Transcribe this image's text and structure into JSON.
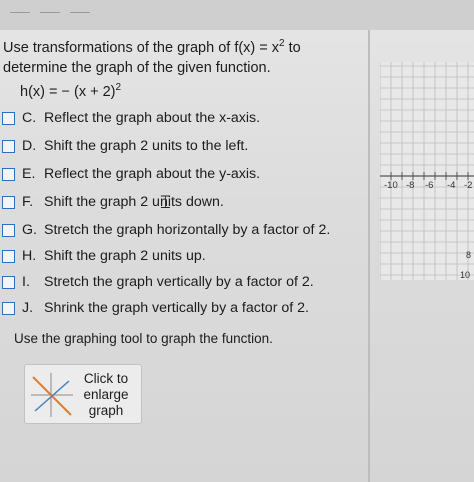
{
  "question": {
    "line1": "Use transformations of the graph of f(x) = x",
    "line1_exp": "2",
    "line1_end": " to",
    "line2": "determine the graph of the given function.",
    "function_base": "h(x) = − (x + 2)",
    "function_exp": "2"
  },
  "options": [
    {
      "letter": "C.",
      "text": "Reflect the graph about the x-axis."
    },
    {
      "letter": "D.",
      "text": "Shift the graph 2 units to the left."
    },
    {
      "letter": "E.",
      "text": "Reflect the graph about the y-axis."
    },
    {
      "letter": "F.",
      "text": "Shift the graph 2 units down."
    },
    {
      "letter": "G.",
      "text": "Stretch the graph horizontally by a factor of 2."
    },
    {
      "letter": "H.",
      "text": "Shift the graph 2 units up."
    },
    {
      "letter": "I.",
      "text": "Stretch the graph vertically by a factor of 2."
    },
    {
      "letter": "J.",
      "text": "Shrink the graph vertically by a factor of 2."
    }
  ],
  "instruction": "Use the graphing tool to graph the function.",
  "enlarge": {
    "line1": "Click to",
    "line2": "enlarge",
    "line3": "graph"
  },
  "graph_axis": {
    "ticks": [
      "-10",
      "-8",
      "-6",
      "-4",
      "-2"
    ],
    "right_labels": [
      "8",
      "10"
    ]
  },
  "colors": {
    "checkbox_border": "#2d6fc0",
    "grid_line": "#bcbcbc",
    "accent_line": "#e07a2f"
  }
}
